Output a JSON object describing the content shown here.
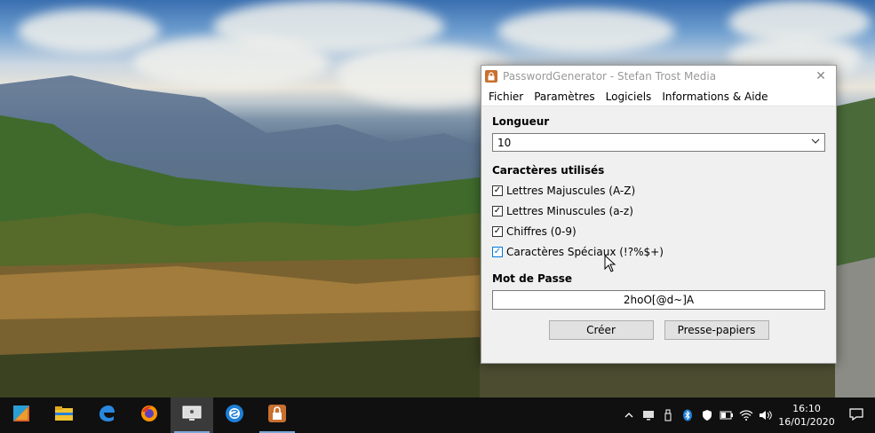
{
  "window": {
    "title": "PasswordGenerator - Stefan Trost Media",
    "close_glyph": "✕"
  },
  "menu": {
    "items": [
      "Fichier",
      "Paramètres",
      "Logiciels",
      "Informations & Aide"
    ]
  },
  "length": {
    "label": "Longueur",
    "value": "10"
  },
  "characters": {
    "label": "Caractères utilisés",
    "options": [
      {
        "label": "Lettres Majuscules (A-Z)",
        "checked": true
      },
      {
        "label": "Lettres Minuscules (a-z)",
        "checked": true
      },
      {
        "label": "Chiffres (0-9)",
        "checked": true
      },
      {
        "label": "Caractères Spéciaux (!?%$+)",
        "checked": true
      }
    ]
  },
  "password": {
    "label": "Mot de Passe",
    "value": "2hoO[@d~]A"
  },
  "buttons": {
    "create": "Créer",
    "clipboard": "Presse-papiers"
  },
  "taskbar": {
    "apps": [
      "start-icon",
      "file-explorer-icon",
      "edge-icon",
      "firefox-icon",
      "monitor-app-icon",
      "stefan-trost-app-icon",
      "password-generator-icon"
    ],
    "clock_time": "16:10",
    "clock_date": "16/01/2020"
  },
  "colors": {
    "accent": "#0078d7",
    "app_icon": "#c8702f",
    "taskbar": "#101010"
  }
}
